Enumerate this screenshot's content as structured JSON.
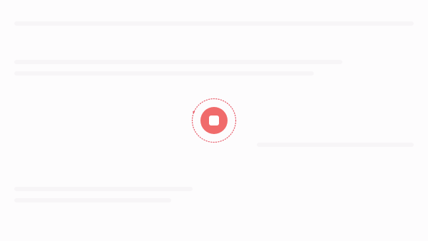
{
  "recorder": {
    "state": "recording",
    "accent_color": "#f06b6b",
    "ring_color": "#e85c6a",
    "icon": "stop-icon"
  }
}
